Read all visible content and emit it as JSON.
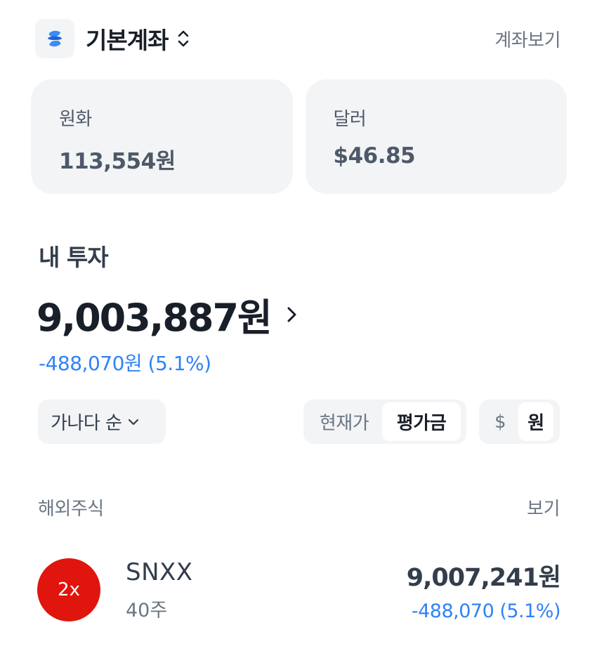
{
  "header": {
    "account_name": "기본계좌",
    "view_accounts": "계좌보기"
  },
  "balances": [
    {
      "label": "원화",
      "value": "113,554원"
    },
    {
      "label": "달러",
      "value": "$46.85"
    }
  ],
  "investment": {
    "title": "내 투자",
    "total": "9,003,887원",
    "change": "-488,070원 (5.1%)"
  },
  "controls": {
    "sort_label": "가나다 순",
    "price_modes": [
      "현재가",
      "평가금"
    ],
    "price_mode_selected": "평가금",
    "currency_modes": [
      "$",
      "원"
    ],
    "currency_selected": "원"
  },
  "section": {
    "title": "해외주식",
    "more": "보기"
  },
  "stocks": [
    {
      "logo_text": "2x",
      "name": "SNXX",
      "quantity": "40주",
      "amount": "9,007,241원",
      "change": "-488,070 (5.1%)"
    }
  ],
  "colors": {
    "accent_blue": "#3182f6",
    "card_bg": "#f2f4f6",
    "stock_logo_red": "#e0150d"
  }
}
